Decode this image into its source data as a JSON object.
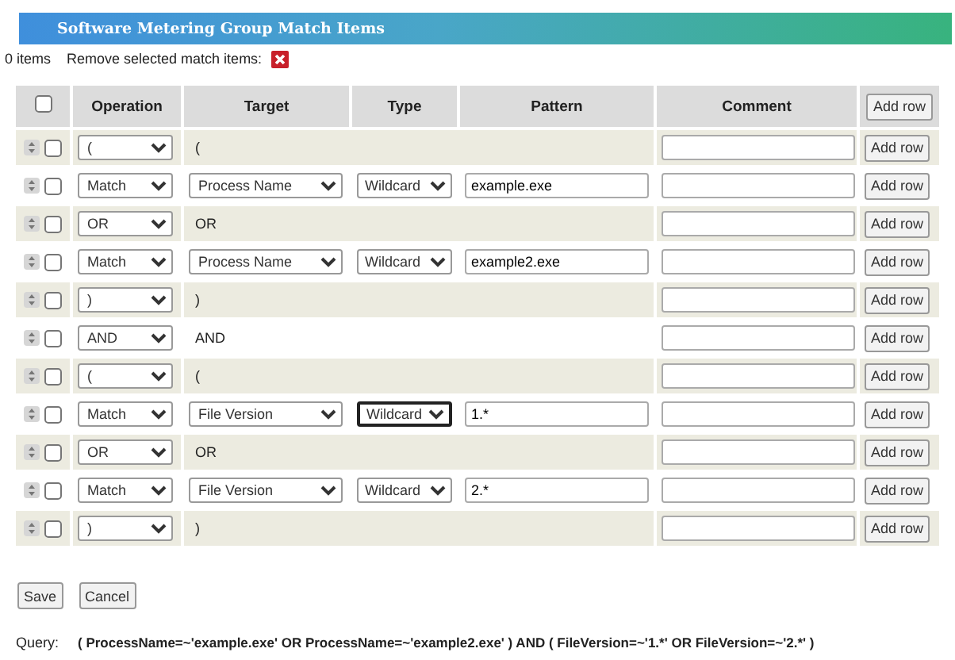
{
  "panel": {
    "title": "Software Metering Group Match Items"
  },
  "toolbar": {
    "count": "0 items",
    "remove_label": "Remove selected match items:"
  },
  "table": {
    "select_all": {
      "checked": false
    },
    "columns": [
      "Operation",
      "Target",
      "Type",
      "Pattern",
      "Comment"
    ],
    "header_button": "Add row",
    "rows": [
      {
        "kind": "operator",
        "checked": false,
        "operation": "(",
        "text": "(",
        "comment": "",
        "button": "Add row"
      },
      {
        "kind": "match",
        "checked": false,
        "operation": "Match",
        "target": "Process Name",
        "type": "Wildcard",
        "type_focused": false,
        "pattern": "example.exe",
        "comment": "",
        "button": "Add row"
      },
      {
        "kind": "operator",
        "checked": false,
        "operation": "OR",
        "text": "OR",
        "comment": "",
        "button": "Add row"
      },
      {
        "kind": "match",
        "checked": false,
        "operation": "Match",
        "target": "Process Name",
        "type": "Wildcard",
        "type_focused": false,
        "pattern": "example2.exe",
        "comment": "",
        "button": "Add row"
      },
      {
        "kind": "operator",
        "checked": false,
        "operation": ")",
        "text": ")",
        "comment": "",
        "button": "Add row"
      },
      {
        "kind": "operator",
        "checked": false,
        "operation": "AND",
        "text": "AND",
        "comment": "",
        "button": "Add row"
      },
      {
        "kind": "operator",
        "checked": false,
        "operation": "(",
        "text": "(",
        "comment": "",
        "button": "Add row"
      },
      {
        "kind": "match",
        "checked": false,
        "operation": "Match",
        "target": "File Version",
        "type": "Wildcard",
        "type_focused": true,
        "pattern": "1.*",
        "comment": "",
        "button": "Add row"
      },
      {
        "kind": "operator",
        "checked": false,
        "operation": "OR",
        "text": "OR",
        "comment": "",
        "button": "Add row"
      },
      {
        "kind": "match",
        "checked": false,
        "operation": "Match",
        "target": "File Version",
        "type": "Wildcard",
        "type_focused": false,
        "pattern": "2.*",
        "comment": "",
        "button": "Add row"
      },
      {
        "kind": "operator",
        "checked": false,
        "operation": ")",
        "text": ")",
        "comment": "",
        "button": "Add row"
      }
    ]
  },
  "buttons": [
    "Save",
    "Cancel"
  ],
  "query": {
    "label": "Query:",
    "text": "( ProcessName=~'example.exe' OR ProcessName=~'example2.exe' ) AND ( FileVersion=~'1.*' OR FileVersion=~'2.*' )"
  }
}
